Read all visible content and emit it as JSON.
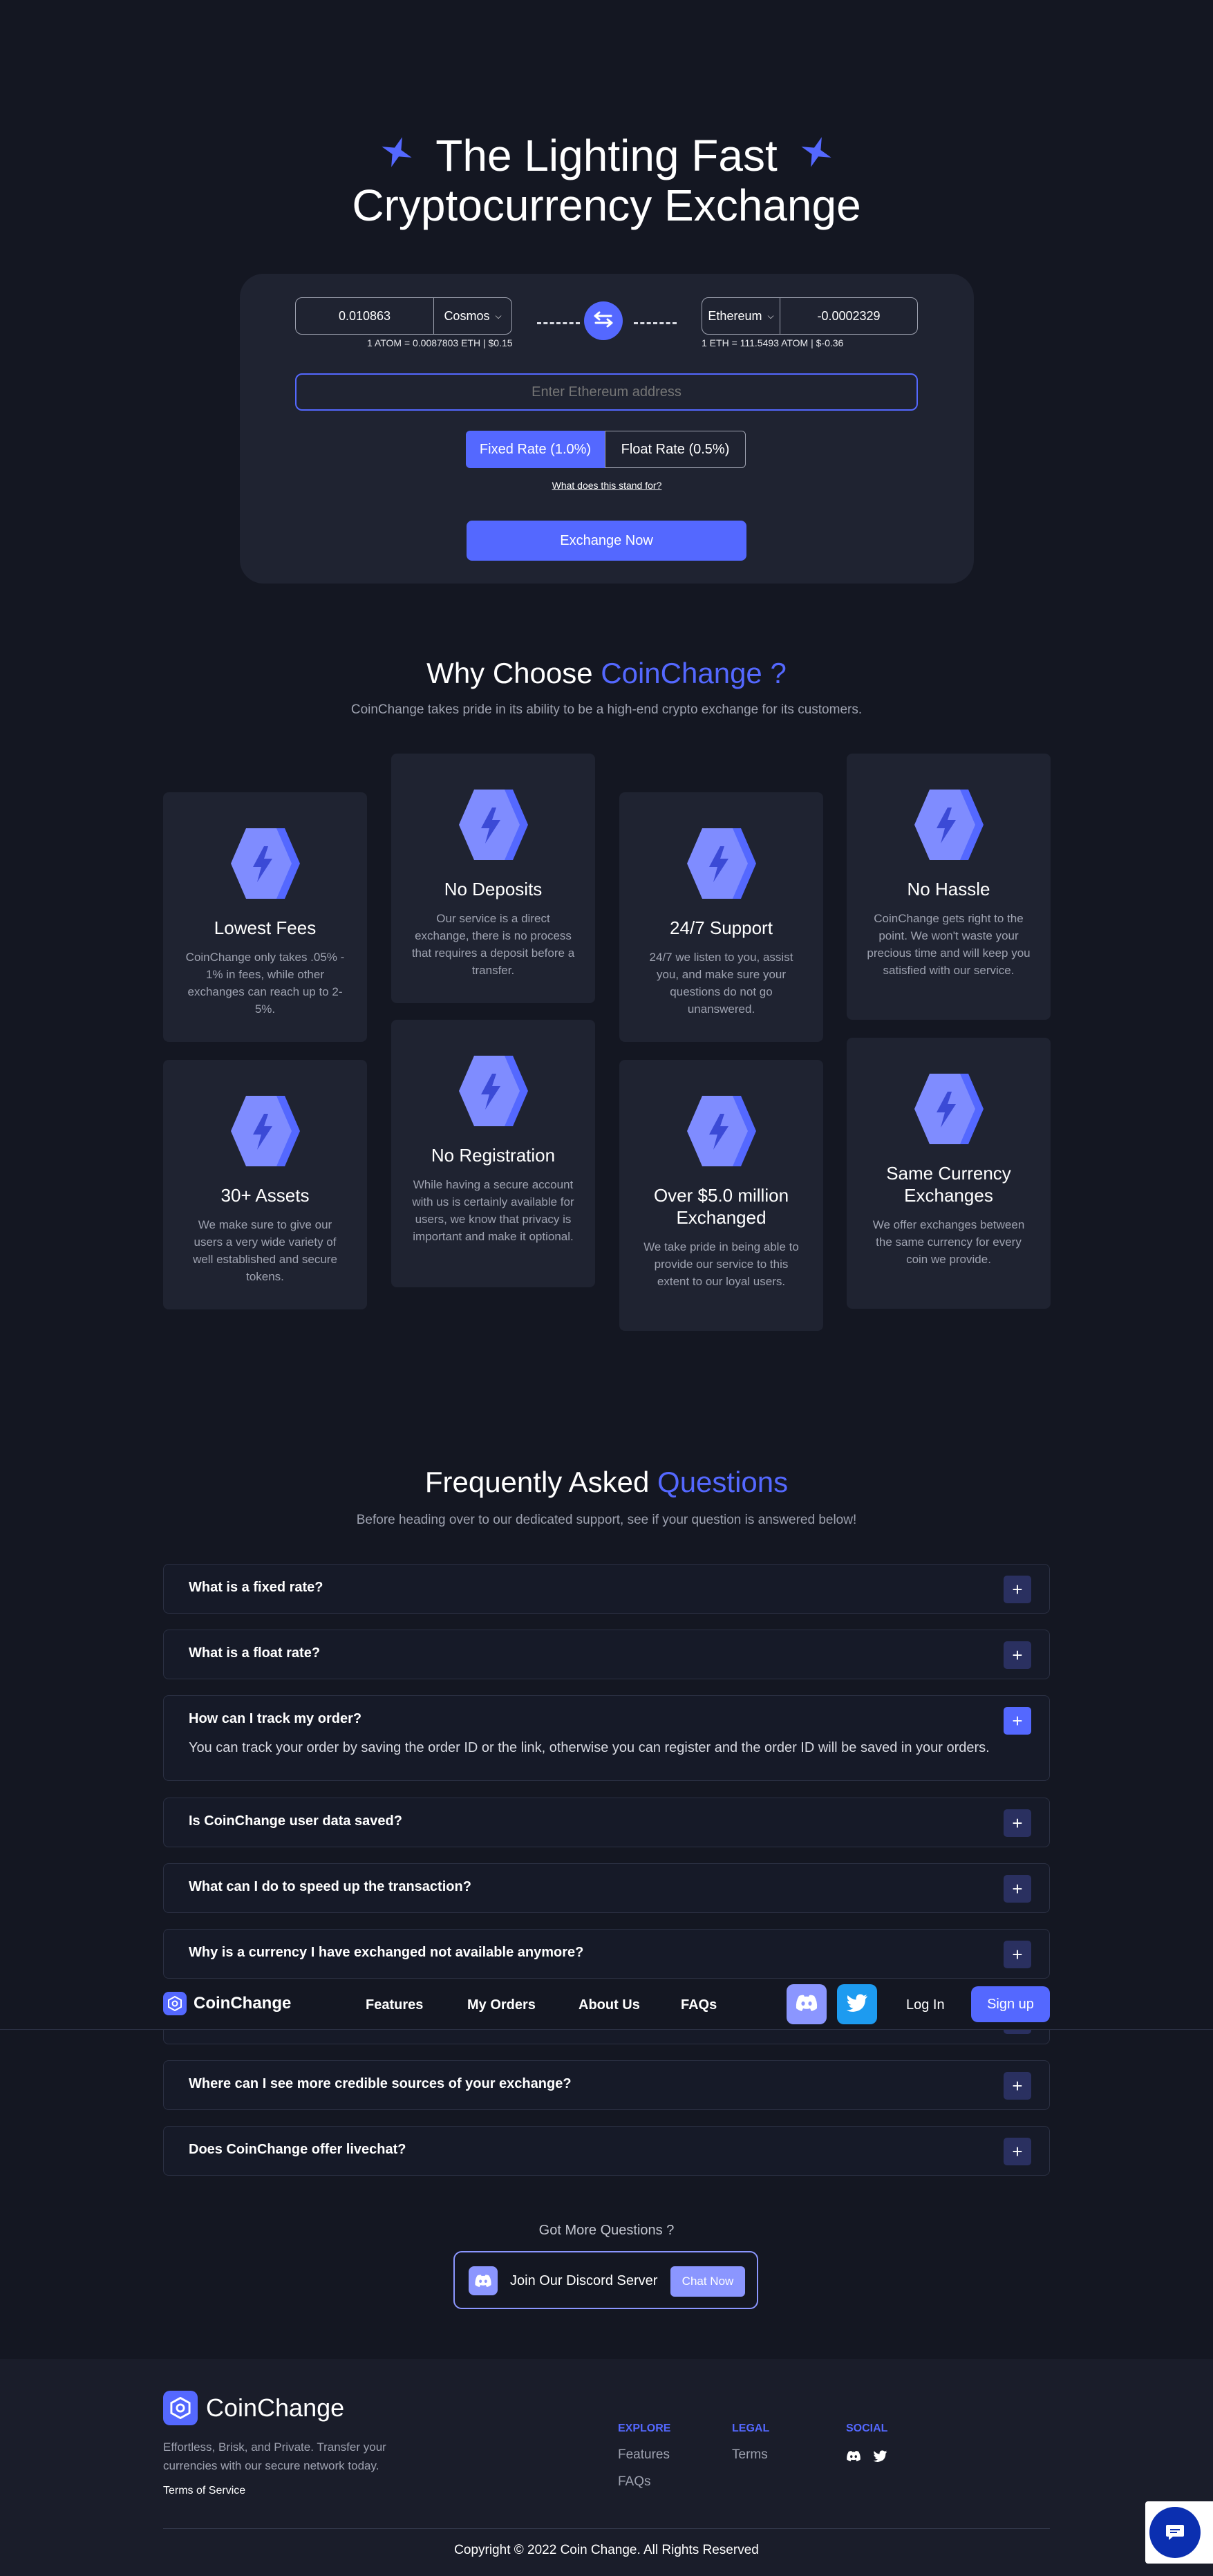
{
  "hero": {
    "title_line1": "The Lighting Fast",
    "title_line2": "Cryptocurrency Exchange"
  },
  "exchange": {
    "from_amount": "0.010863",
    "from_currency": "Cosmos",
    "from_rate": "1 ATOM = 0.0087803 ETH | $0.15",
    "to_currency": "Ethereum",
    "to_amount": "-0.0002329",
    "to_rate": "1 ETH = 111.5493 ATOM | $-0.36",
    "address_placeholder": "Enter Ethereum address",
    "fixed_rate_label": "Fixed Rate (1.0%)",
    "float_rate_label": "Float Rate (0.5%)",
    "stand_for_link": "What does this stand for?",
    "exchange_button": "Exchange Now"
  },
  "why": {
    "title_prefix": "Why Choose ",
    "title_accent": "CoinChange ?",
    "subtitle": "CoinChange takes pride in its ability to be a high-end crypto exchange for its customers.",
    "features": [
      {
        "title": "Lowest Fees",
        "text": "CoinChange only takes .05% - 1% in fees, while other exchanges can reach up to 2-5%."
      },
      {
        "title": "No Deposits",
        "text": "Our service is a direct exchange, there is no process that requires a deposit before a transfer."
      },
      {
        "title": "24/7 Support",
        "text": "24/7 we listen to you, assist you, and make sure your questions do not go unanswered."
      },
      {
        "title": "No Hassle",
        "text": "CoinChange gets right to the point. We won't waste your precious time and will keep you satisfied with our service."
      },
      {
        "title": "30+ Assets",
        "text": "We make sure to give our users a very wide variety of well established and secure tokens."
      },
      {
        "title": "No Registration",
        "text": "While having a secure account with us is certainly available for users, we know that privacy is important and make it optional."
      },
      {
        "title": "Over $5.0 million Exchanged",
        "text": "We take pride in being able to provide our service to this extent to our loyal users."
      },
      {
        "title": "Same Currency Exchanges",
        "text": "We offer exchanges between the same currency for every coin we provide."
      }
    ]
  },
  "faq": {
    "title_prefix": "Frequently Asked ",
    "title_accent": "Questions",
    "subtitle": "Before heading over to our dedicated support, see if your question is answered below!",
    "items": [
      {
        "q": "What is a fixed rate?"
      },
      {
        "q": "What is a float rate?"
      },
      {
        "q": "How can I track my order?",
        "a": "You can track your order by saving the order ID or the link, otherwise you can register and the order ID will be saved in your orders."
      },
      {
        "q": "Is CoinChange user data saved?"
      },
      {
        "q": "What can I do to speed up the transaction?"
      },
      {
        "q": "Why is a currency I have exchanged not available anymore?"
      },
      {
        "q": "Where can I see more credible sources of your exchange?"
      },
      {
        "q": "Does CoinChange offer livechat?"
      }
    ],
    "plus": "+"
  },
  "navbar": {
    "logo": "CoinChange",
    "links": [
      "Features",
      "My Orders",
      "About Us",
      "FAQs"
    ],
    "login": "Log In",
    "signup": "Sign up"
  },
  "more": {
    "heading": "Got More Questions ?",
    "discord_label": "Join Our Discord Server",
    "chat_button": "Chat Now"
  },
  "footer": {
    "logo": "CoinChange",
    "tagline": "Effortless, Brisk, and Private. Transfer your currencies with our secure network today.",
    "terms_link": "Terms of Service",
    "explore_heading": "EXPLORE",
    "explore_links": [
      "Features",
      "FAQs"
    ],
    "legal_heading": "LEGAL",
    "legal_links": [
      "Terms"
    ],
    "social_heading": "SOCIAL",
    "copyright": "Copyright © 2022 Coin Change. All Rights Reserved"
  },
  "colors": {
    "background": "#141722",
    "card": "#1f2331",
    "accent": "#5468ff",
    "muted_text": "#9ea2b0",
    "discord": "#8b96ff",
    "twitter": "#1d9bf0"
  },
  "icons": {
    "hero_star": "four-point-star-icon",
    "swap": "swap-arrows-icon",
    "feature": "lightning-hexagon-icon",
    "discord": "discord-icon",
    "twitter": "twitter-icon",
    "chat": "chat-bubble-icon"
  }
}
